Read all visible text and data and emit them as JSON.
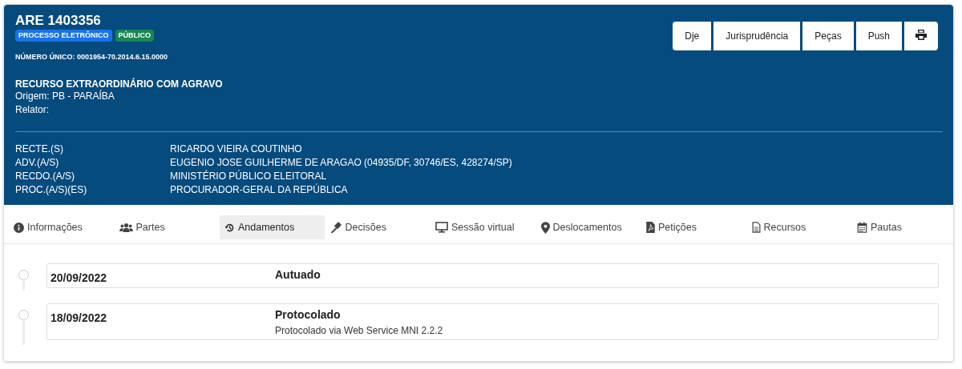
{
  "header": {
    "title": "ARE 1403356",
    "badges": [
      {
        "label": "PROCESSO ELETRÔNICO",
        "color": "#1a73e8"
      },
      {
        "label": "PÚBLICO",
        "color": "#198754"
      }
    ],
    "numero_unico": "NÚMERO ÚNICO: 0001954-70.2014.6.15.0000",
    "classe": "RECURSO EXTRAORDINÁRIO COM AGRAVO",
    "origem": "Origem: PB - PARAÍBA",
    "relator": "Relator:",
    "buttons": [
      "Dje",
      "Jurisprudência",
      "Peças",
      "Push"
    ],
    "parties": [
      {
        "role": "RECTE.(S)",
        "name": "RICARDO VIEIRA COUTINHO"
      },
      {
        "role": "ADV.(A/S)",
        "name": "EUGENIO JOSE GUILHERME DE ARAGAO (04935/DF, 30746/ES, 428274/SP)"
      },
      {
        "role": "RECDO.(A/S)",
        "name": "MINISTÉRIO PÚBLICO ELEITORAL"
      },
      {
        "role": "PROC.(A/S)(ES)",
        "name": "PROCURADOR-GERAL DA REPÚBLICA"
      }
    ]
  },
  "tabs": [
    {
      "label": "Informações",
      "selected": false
    },
    {
      "label": "Partes",
      "selected": false
    },
    {
      "label": "Andamentos",
      "selected": true
    },
    {
      "label": "Decisões",
      "selected": false
    },
    {
      "label": "Sessão virtual",
      "selected": false
    },
    {
      "label": "Deslocamentos",
      "selected": false
    },
    {
      "label": "Petições",
      "selected": false
    },
    {
      "label": "Recursos",
      "selected": false
    },
    {
      "label": "Pautas",
      "selected": false
    }
  ],
  "andamentos": [
    {
      "date": "20/09/2022",
      "title": "Autuado"
    },
    {
      "date": "18/09/2022",
      "title": "Protocolado",
      "description": "Protocolado via Web Service MNI 2.2.2"
    }
  ]
}
